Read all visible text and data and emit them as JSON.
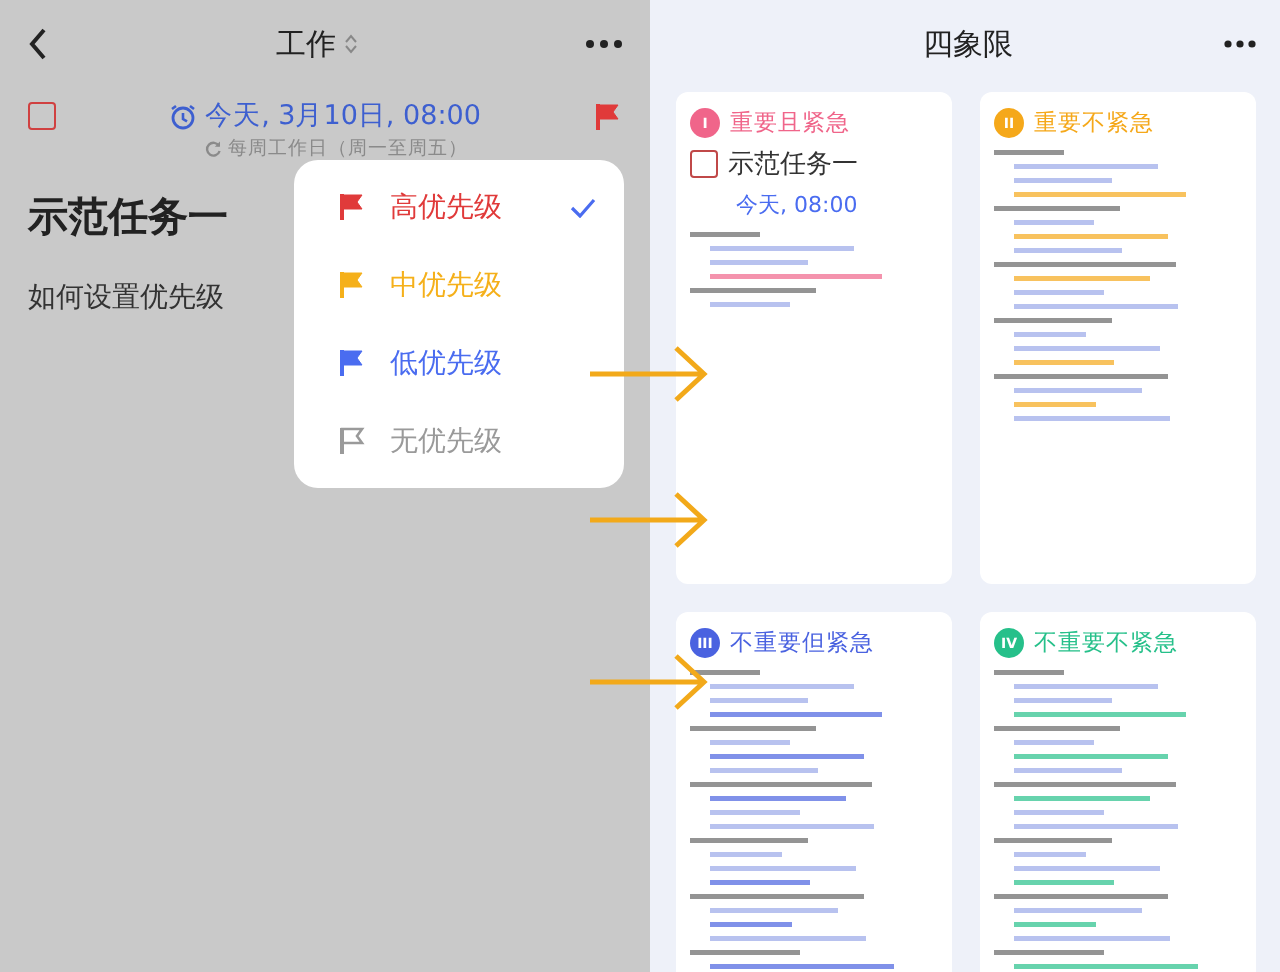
{
  "task_panel": {
    "title": "工作",
    "due": "今天, 3月10日, 08:00",
    "repeat": "每周工作日（周一至周五）",
    "checked": false,
    "task_title": "示范任务一",
    "note": "如何设置优先级"
  },
  "priority_menu": [
    {
      "label": "高优先级",
      "color": "#e03a3a",
      "kind": "filled",
      "selected": true
    },
    {
      "label": "中优先级",
      "color": "#f5b01a",
      "kind": "filled",
      "selected": false
    },
    {
      "label": "低优先级",
      "color": "#4a6cf0",
      "kind": "filled",
      "selected": false
    },
    {
      "label": "无优先级",
      "color": "#9a9a9a",
      "kind": "outline",
      "selected": false
    }
  ],
  "matrix": {
    "title": "四象限",
    "quadrants": [
      {
        "numeral": "I",
        "title": "重要且紧急",
        "color": "#f0658a",
        "tasks": [
          {
            "title": "示范任务一",
            "due": "今天, 08:00",
            "checked": false
          }
        ]
      },
      {
        "numeral": "II",
        "title": "重要不紧急",
        "color": "#f5a81a"
      },
      {
        "numeral": "III",
        "title": "不重要但紧急",
        "color": "#4a62e0"
      },
      {
        "numeral": "IV",
        "title": "不重要不紧急",
        "color": "#26c08a"
      }
    ]
  }
}
